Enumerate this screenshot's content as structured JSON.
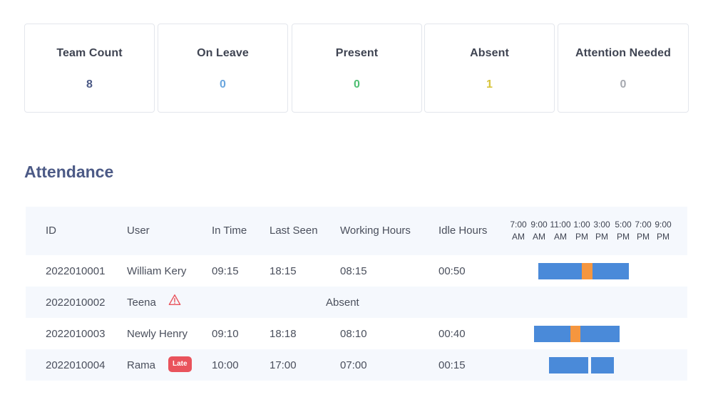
{
  "summary": {
    "cards": [
      {
        "label": "Team Count",
        "value": "8",
        "color": "#4c5a86"
      },
      {
        "label": "On Leave",
        "value": "0",
        "color": "#6aa6de"
      },
      {
        "label": "Present",
        "value": "0",
        "color": "#4fbf73"
      },
      {
        "label": "Absent",
        "value": "1",
        "color": "#d8c43a"
      },
      {
        "label": "Attention Needed",
        "value": "0",
        "color": "#a6a9b0"
      }
    ]
  },
  "attendance": {
    "title": "Attendance",
    "columns": {
      "id": "ID",
      "user": "User",
      "in_time": "In Time",
      "last_seen": "Last Seen",
      "working_hours": "Working Hours",
      "idle_hours": "Idle Hours"
    },
    "timeline_ticks": [
      {
        "time": "7:00",
        "period": "AM"
      },
      {
        "time": "9:00",
        "period": "AM"
      },
      {
        "time": "11:00",
        "period": "AM"
      },
      {
        "time": "1:00",
        "period": "PM"
      },
      {
        "time": "3:00",
        "period": "PM"
      },
      {
        "time": "5:00",
        "period": "PM"
      },
      {
        "time": "7:00",
        "period": "PM"
      },
      {
        "time": "9:00",
        "period": "PM"
      }
    ],
    "rows": [
      {
        "id": "2022010001",
        "user": "William Kery",
        "in_time": "09:15",
        "last_seen": "18:15",
        "working_hours": "08:15",
        "idle_hours": "00:50"
      },
      {
        "id": "2022010002",
        "user": "Teena",
        "status": "Absent",
        "icon": "warning-icon"
      },
      {
        "id": "2022010003",
        "user": "Newly Henry",
        "in_time": "09:10",
        "last_seen": "18:18",
        "working_hours": "08:10",
        "idle_hours": "00:40"
      },
      {
        "id": "2022010004",
        "user": "Rama",
        "badge": "Late",
        "in_time": "10:00",
        "last_seen": "17:00",
        "working_hours": "07:00",
        "idle_hours": "00:15"
      }
    ],
    "colors": {
      "active": "#4a8ad9",
      "idle": "#f5963f",
      "late_badge": "#e9535c",
      "warning": "#e9535c"
    }
  }
}
